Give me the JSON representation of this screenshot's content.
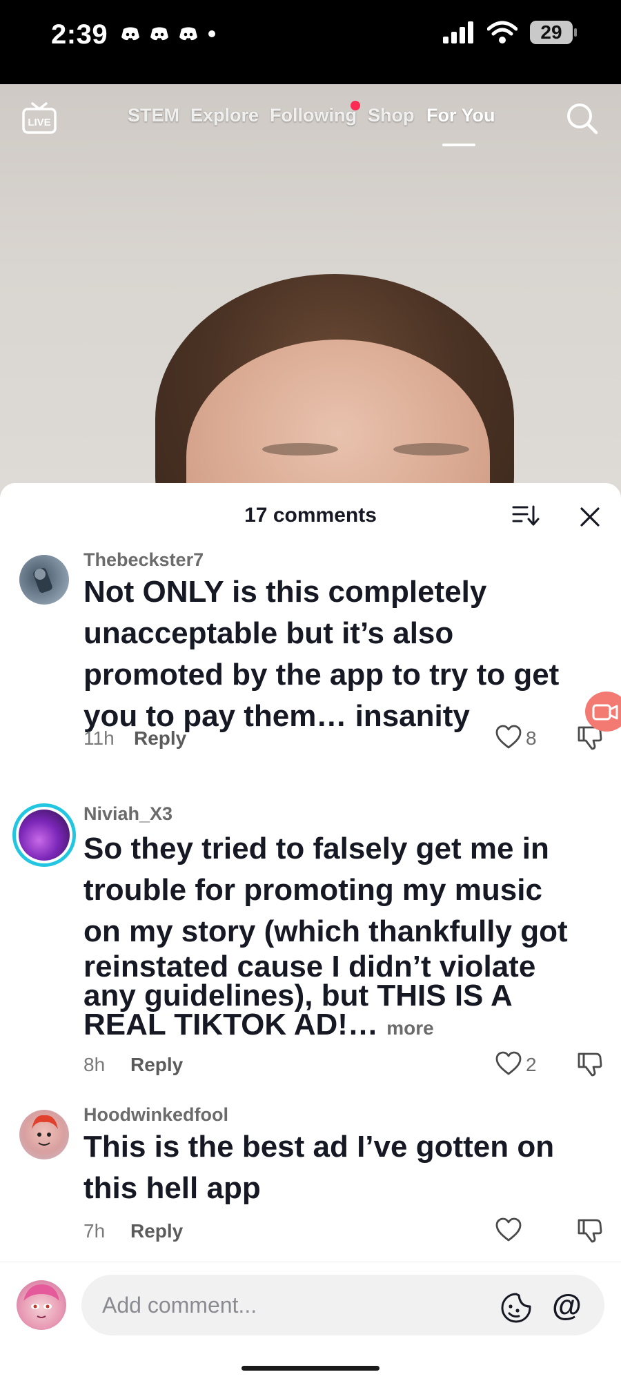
{
  "status_bar": {
    "time": "2:39",
    "battery": "29"
  },
  "top_nav": {
    "tabs": [
      {
        "label": "STEM"
      },
      {
        "label": "Explore"
      },
      {
        "label": "Following"
      },
      {
        "label": "Shop"
      },
      {
        "label": "For You"
      }
    ],
    "active_tab": "For You",
    "live_label": "LIVE"
  },
  "comments_panel": {
    "title": "17 comments",
    "comments": [
      {
        "username": "Thebeckster7",
        "text": "Not ONLY is this completely unacceptable but it’s also promoted by the app to try to get you to pay them… insanity",
        "time": "11h",
        "reply_label": "Reply",
        "likes": "8"
      },
      {
        "username": "Niviah_X3",
        "text_lines": [
          "So they tried to falsely get me in",
          "trouble for promoting my music",
          "on my story (which thankfully got",
          "reinstated cause I didn’t violate",
          "any guidelines), but THIS IS A",
          "REAL TIKTOK AD!…"
        ],
        "more_label": "more",
        "time": "8h",
        "reply_label": "Reply",
        "likes": "2"
      },
      {
        "username": "Hoodwinkedfool",
        "text": "This is the best ad I’ve gotten on this hell app",
        "time": "7h",
        "reply_label": "Reply",
        "likes": ""
      }
    ]
  },
  "composer": {
    "placeholder": "Add comment...",
    "mention_symbol": "@"
  },
  "colors": {
    "accent": "#fe2c55",
    "text": "#161823",
    "muted": "#7a7a7a"
  }
}
